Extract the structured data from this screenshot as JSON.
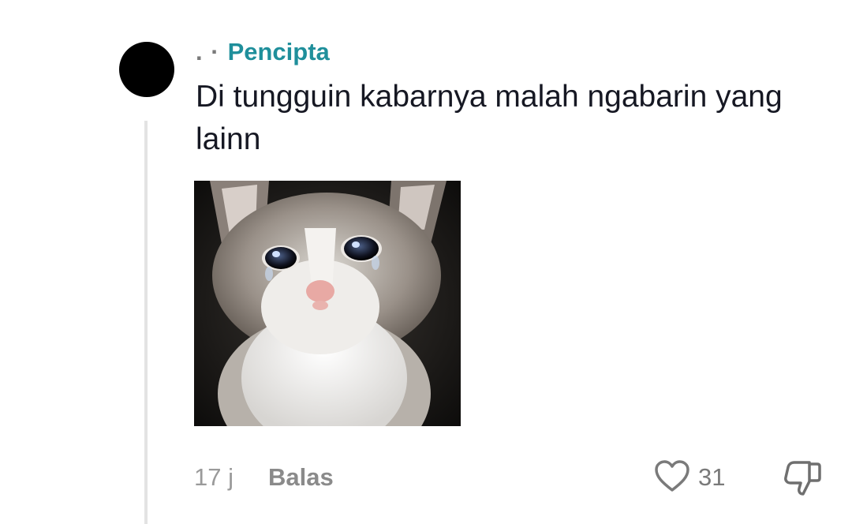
{
  "comment": {
    "username": ". ·",
    "badge": "Pencipta",
    "text": "Di tungguin kabarnya malah ngabarin yang lainn",
    "sticker_icon": "crying-cat-sticker",
    "timestamp": "17 j",
    "reply_label": "Balas",
    "like_count": "31",
    "like_icon": "heart-icon",
    "dislike_icon": "thumbs-down-icon"
  },
  "colors": {
    "badge": "#1f8f9b",
    "text": "#161823",
    "muted": "#9a9a9a",
    "thread_line": "#e3e3e3"
  }
}
